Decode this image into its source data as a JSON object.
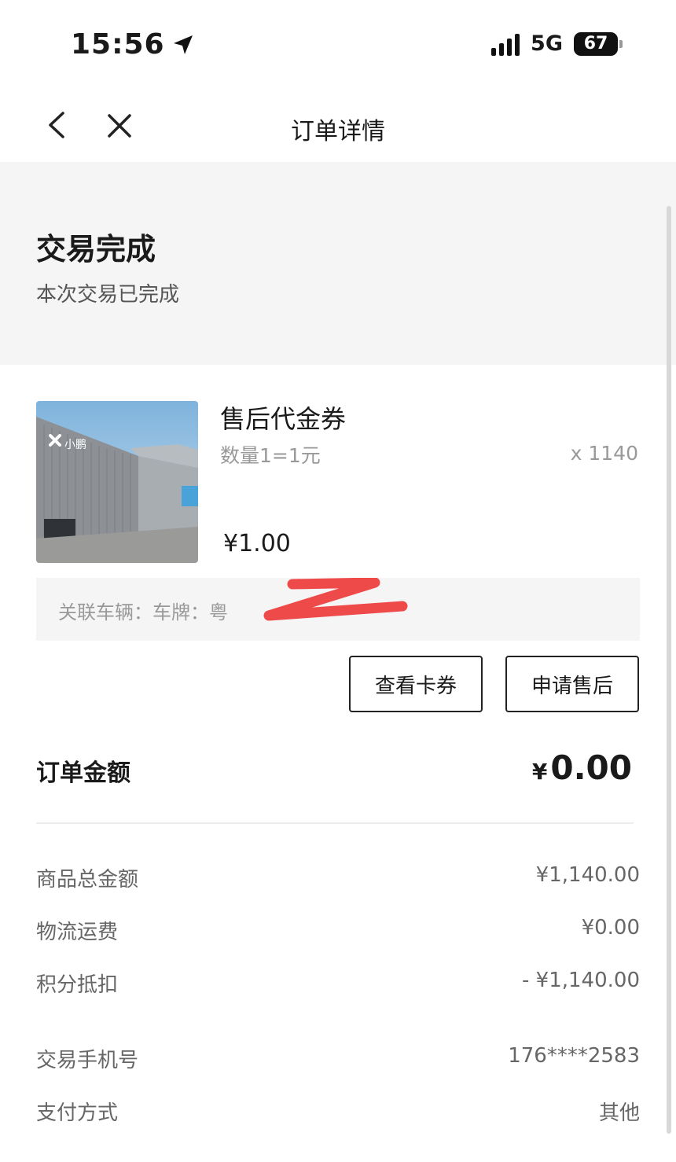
{
  "status_bar": {
    "time": "15:56",
    "network": "5G",
    "battery": "67"
  },
  "nav": {
    "title": "订单详情"
  },
  "order_status": {
    "title": "交易完成",
    "subtitle": "本次交易已完成"
  },
  "product": {
    "name": "售后代金券",
    "spec": "数量1=1元",
    "quantity": "x 1140",
    "price": "¥1.00",
    "image_caption": "小鹏"
  },
  "vehicle": {
    "label": "关联车辆：车牌：粤"
  },
  "buttons": {
    "view_coupon": "查看卡券",
    "apply_aftersale": "申请售后"
  },
  "order_total": {
    "label": "订单金额",
    "currency": "¥",
    "amount": "0.00"
  },
  "details": [
    {
      "label": "商品总金额",
      "value": "¥1,140.00"
    },
    {
      "label": "物流运费",
      "value": "¥0.00"
    },
    {
      "label": "积分抵扣",
      "value": "- ¥1,140.00"
    },
    {
      "label": "交易手机号",
      "value": "176****2583"
    },
    {
      "label": "支付方式",
      "value": "其他"
    }
  ],
  "colors": {
    "redaction": "#ee3b3b",
    "section_bg": "#f5f5f5"
  }
}
